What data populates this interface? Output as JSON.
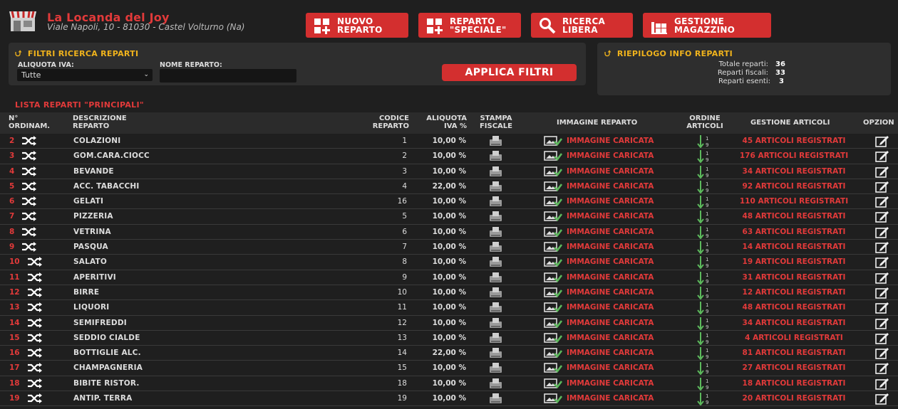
{
  "header": {
    "shop_name": "La Locanda del Joy",
    "address": "Viale Napoli, 10 - 81030 - Castel Volturno (Na)",
    "buttons": [
      {
        "label": "NUOVO\nREPARTO",
        "icon": "grid-plus-icon"
      },
      {
        "label": "REPARTO\n\"SPECIALE\"",
        "icon": "grid-plus-icon"
      },
      {
        "label": "RICERCA\nLIBERA",
        "icon": "magnifier-icon"
      },
      {
        "label": "GESTIONE\nMAGAZZINO",
        "icon": "warehouse-icon"
      }
    ]
  },
  "filters": {
    "title": "FILTRI RICERCA REPARTI",
    "iva_label": "ALIQUOTA IVA:",
    "iva_value": "Tutte",
    "name_label": "NOME REPARTO:",
    "name_value": "",
    "apply_label": "APPLICA FILTRI"
  },
  "summary": {
    "title": "RIEPILOGO INFO REPARTI",
    "total_label": "Totale reparti:",
    "total_value": "36",
    "fiscal_label": "Reparti fiscali:",
    "fiscal_value": "33",
    "exempt_label": "Reparti esenti:",
    "exempt_value": "3"
  },
  "list": {
    "title": "LISTA REPARTI \"PRINCIPALI\"",
    "columns": {
      "num": "N°\nORDINAM.",
      "desc": "DESCRIZIONE\nREPARTO",
      "code": "CODICE\nREPARTO",
      "iva": "ALIQUOTA\nIVA %",
      "print": "STAMPA\nFISCALE",
      "image": "IMMAGINE REPARTO",
      "order": "ORDINE\nARTICOLI",
      "articles": "GESTIONE ARTICOLI",
      "options": "OPZION"
    },
    "image_status": "IMMAGINE CARICATA",
    "order_digits": "1\n9",
    "rows": [
      {
        "num": "2",
        "desc": "COLAZIONI",
        "code": "1",
        "iva": "10,00 %",
        "articles": "45 ARTICOLI REGISTRATI"
      },
      {
        "num": "3",
        "desc": "GOM.CARA.CIOCC",
        "code": "2",
        "iva": "10,00 %",
        "articles": "176 ARTICOLI REGISTRATI"
      },
      {
        "num": "4",
        "desc": "BEVANDE",
        "code": "3",
        "iva": "10,00 %",
        "articles": "34 ARTICOLI REGISTRATI"
      },
      {
        "num": "5",
        "desc": "ACC. TABACCHI",
        "code": "4",
        "iva": "22,00 %",
        "articles": "92 ARTICOLI REGISTRATI"
      },
      {
        "num": "6",
        "desc": "GELATI",
        "code": "16",
        "iva": "10,00 %",
        "articles": "110 ARTICOLI REGISTRATI"
      },
      {
        "num": "7",
        "desc": "PIZZERIA",
        "code": "5",
        "iva": "10,00 %",
        "articles": "48 ARTICOLI REGISTRATI"
      },
      {
        "num": "8",
        "desc": "VETRINA",
        "code": "6",
        "iva": "10,00 %",
        "articles": "63 ARTICOLI REGISTRATI"
      },
      {
        "num": "9",
        "desc": "PASQUA",
        "code": "7",
        "iva": "10,00 %",
        "articles": "14 ARTICOLI REGISTRATI"
      },
      {
        "num": "10",
        "desc": "SALATO",
        "code": "8",
        "iva": "10,00 %",
        "articles": "19 ARTICOLI REGISTRATI"
      },
      {
        "num": "11",
        "desc": "APERITIVI",
        "code": "9",
        "iva": "10,00 %",
        "articles": "31 ARTICOLI REGISTRATI"
      },
      {
        "num": "12",
        "desc": "BIRRE",
        "code": "10",
        "iva": "10,00 %",
        "articles": "12 ARTICOLI REGISTRATI"
      },
      {
        "num": "13",
        "desc": "LIQUORI",
        "code": "11",
        "iva": "10,00 %",
        "articles": "48 ARTICOLI REGISTRATI"
      },
      {
        "num": "14",
        "desc": "SEMIFREDDI",
        "code": "12",
        "iva": "10,00 %",
        "articles": "34 ARTICOLI REGISTRATI"
      },
      {
        "num": "15",
        "desc": "SEDDIO CIALDE",
        "code": "13",
        "iva": "10,00 %",
        "articles": "4 ARTICOLI REGISTRATI"
      },
      {
        "num": "16",
        "desc": "BOTTIGLIE ALC.",
        "code": "14",
        "iva": "22,00 %",
        "articles": "81 ARTICOLI REGISTRATI"
      },
      {
        "num": "17",
        "desc": "CHAMPAGNERIA",
        "code": "15",
        "iva": "10,00 %",
        "articles": "27 ARTICOLI REGISTRATI"
      },
      {
        "num": "18",
        "desc": "BIBITE RISTOR.",
        "code": "18",
        "iva": "10,00 %",
        "articles": "18 ARTICOLI REGISTRATI"
      },
      {
        "num": "19",
        "desc": "ANTIP. TERRA",
        "code": "19",
        "iva": "10,00 %",
        "articles": "20 ARTICOLI REGISTRATI"
      }
    ]
  },
  "colors": {
    "accent_red": "#d32f2f",
    "text_red": "#e23a3a",
    "title_yellow": "#f0b31c",
    "background": "#1f1f1f",
    "panel": "#2e2e2e",
    "ok_green": "#5cb85c"
  }
}
